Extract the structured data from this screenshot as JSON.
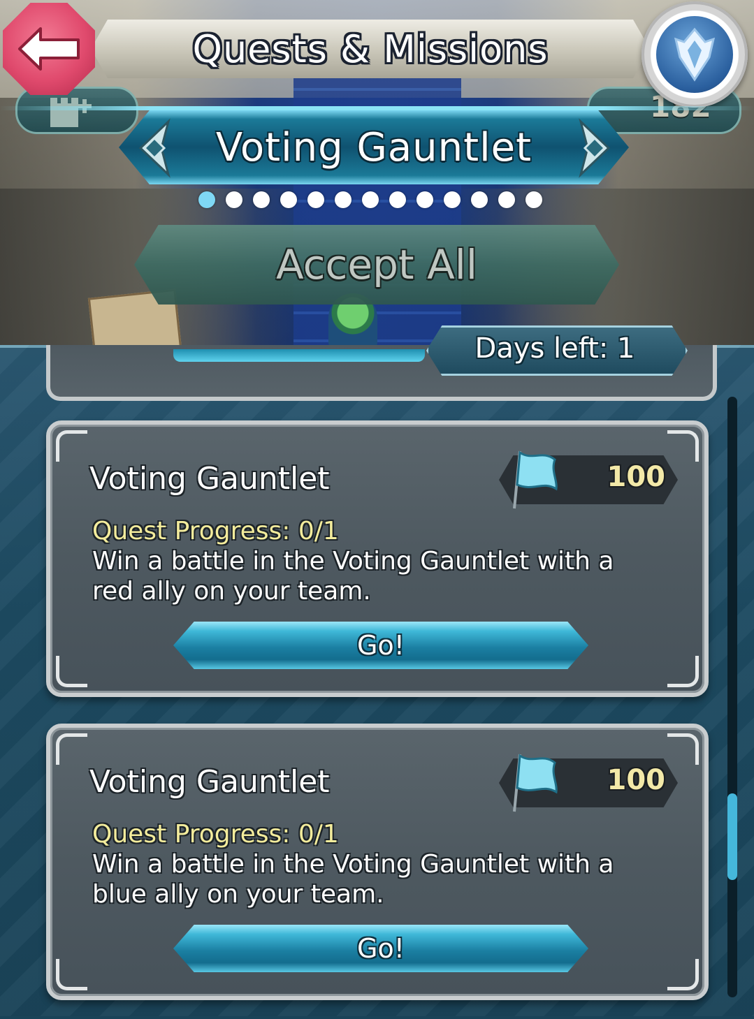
{
  "header": {
    "title": "Quests & Missions",
    "orb_count": "182"
  },
  "category": {
    "title": "Voting Gauntlet",
    "page_count": 13,
    "active_page_index": 0
  },
  "accept_all_label": "Accept All",
  "days_left": "Days left: 1",
  "quests": [
    {
      "title": "Voting Gauntlet",
      "reward_icon": "feather-flag-icon",
      "reward_value": "100",
      "progress": "Quest Progress: 0/1",
      "description": "Win a battle in the Voting Gauntlet with a red ally on your team.",
      "button_label": "Go!"
    },
    {
      "title": "Voting Gauntlet",
      "reward_icon": "feather-flag-icon",
      "reward_value": "100",
      "progress": "Quest Progress: 0/1",
      "description": "Win a battle in the Voting Gauntlet with a blue ally on your team.",
      "button_label": "Go!"
    }
  ],
  "colors": {
    "accent": "#45b7db",
    "progress_text": "#f3ec9c",
    "reward_text": "#f3e9a8",
    "back_button": "#e04a6d"
  }
}
